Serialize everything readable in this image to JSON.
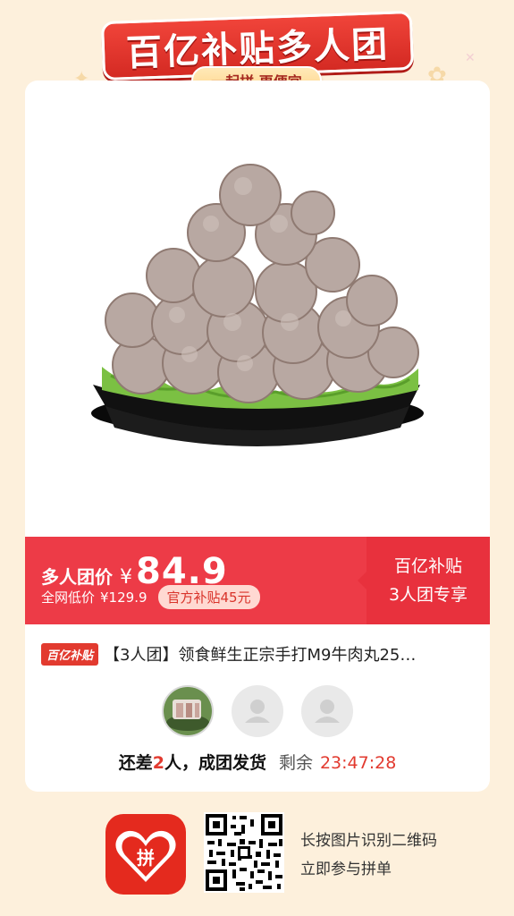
{
  "banner": {
    "title": "百亿补贴多人团",
    "subtitle": "一起拼 更便宜"
  },
  "price": {
    "label": "多人团价",
    "currency": "¥",
    "amount": "84.9",
    "original_label": "全网低价",
    "original_price": "¥129.9",
    "subsidy_tag": "官方补贴45元",
    "promo_line1": "百亿补贴",
    "promo_line2": "3人团专享"
  },
  "product": {
    "badge": "百亿补贴",
    "title": "【3人团】领食鲜生正宗手打M9牛肉丸25…"
  },
  "group": {
    "need_prefix": "还差",
    "need_count": "2",
    "need_suffix": "人，成团发货",
    "remain_label": "剩余",
    "countdown": "23:47:28"
  },
  "footer": {
    "logo_text": "拼",
    "line1": "长按图片识别二维码",
    "line2": "立即参与拼单"
  },
  "colors": {
    "accent_red": "#ed3b47",
    "background": "#fdf0dc"
  }
}
